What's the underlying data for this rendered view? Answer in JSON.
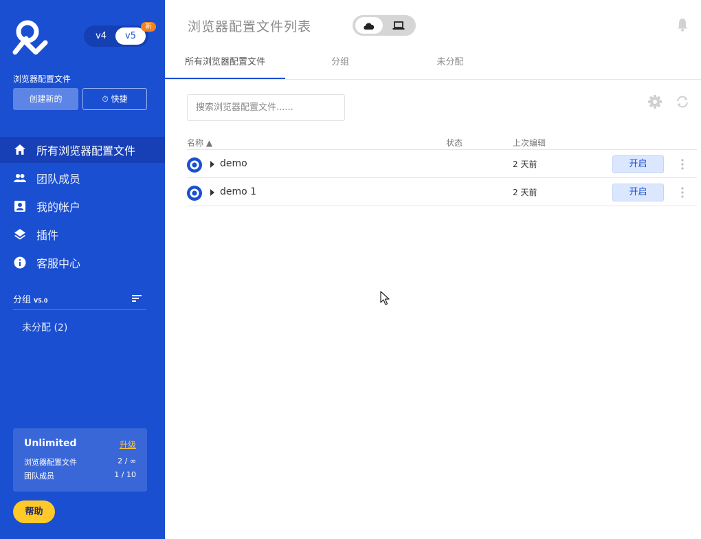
{
  "sidebar": {
    "versions": {
      "v4": "v4",
      "v5": "v5",
      "badge": "新"
    },
    "section_label": "浏览器配置文件",
    "create_label": "创建新的",
    "quick_label": "快捷",
    "nav": [
      {
        "label": "所有浏览器配置文件",
        "icon": "home-icon",
        "active": true
      },
      {
        "label": "团队成员",
        "icon": "people-icon",
        "active": false
      },
      {
        "label": "我的帐户",
        "icon": "account-box-icon",
        "active": false
      },
      {
        "label": "插件",
        "icon": "layers-icon",
        "active": false
      },
      {
        "label": "客服中心",
        "icon": "info-icon",
        "active": false
      }
    ],
    "groups": {
      "title": "分组",
      "version": "V5.0",
      "unassigned": "未分配 (2)"
    },
    "plan": {
      "name": "Unlimited",
      "upgrade": "升级",
      "profiles_label": "浏览器配置文件",
      "profiles_value": "2 / ∞",
      "members_label": "团队成员",
      "members_value": "1 / 10"
    },
    "help_label": "帮助"
  },
  "main": {
    "title": "浏览器配置文件列表",
    "tabs": [
      {
        "label": "所有浏览器配置文件",
        "active": true
      },
      {
        "label": "分组",
        "active": false
      },
      {
        "label": "未分配",
        "active": false
      }
    ],
    "search_placeholder": "搜索浏览器配置文件......",
    "table": {
      "headers": {
        "name": "名称 ▲",
        "status": "状态",
        "last_edit": "上次编辑"
      },
      "rows": [
        {
          "name": "demo",
          "status": "",
          "last_edit": "2 天前",
          "action": "开启"
        },
        {
          "name": "demo 1",
          "status": "",
          "last_edit": "2 天前",
          "action": "开启"
        }
      ]
    }
  },
  "colors": {
    "sidebar_bg": "#1b4fd1",
    "accent_yellow": "#ffc928",
    "badge_orange": "#f5821f",
    "open_button_bg": "#dbe7ff"
  }
}
